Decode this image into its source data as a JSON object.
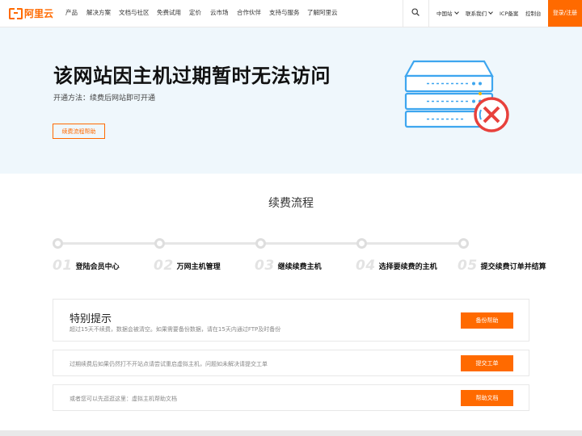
{
  "header": {
    "logo_text": "阿里云",
    "nav": [
      "产品",
      "解决方案",
      "文档与社区",
      "免费试用",
      "定价",
      "云市场",
      "合作伙伴",
      "支持与服务",
      "了解阿里云"
    ],
    "region": "中国站",
    "contact": "联系我们",
    "icp": "ICP备案",
    "console": "控制台",
    "login": "登录/注册"
  },
  "hero": {
    "title": "该网站因主机过期暂时无法访问",
    "subtitle": "开通方法：续费后网站即可开通",
    "button": "续费流程帮助"
  },
  "flow": {
    "title": "续费流程",
    "steps": [
      {
        "num": "01",
        "label": "登陆会员中心"
      },
      {
        "num": "02",
        "label": "万网主机管理"
      },
      {
        "num": "03",
        "label": "继续续费主机"
      },
      {
        "num": "04",
        "label": "选择要续费的主机"
      },
      {
        "num": "05",
        "label": "提交续费订单并结算"
      }
    ]
  },
  "notices": {
    "title": "特别提示",
    "items": [
      {
        "text": "超过15天不续费，数据会被清空。如果需要备份数据，请在15天内通过FTP及时备份",
        "button": "备份帮助"
      },
      {
        "text": "过期续费后如果仍然打不开站点请尝试重启虚拟主机，问题如未解决请提交工单",
        "button": "提交工单"
      },
      {
        "text": "或者您可以先逛逛这里：虚拟主机帮助文档",
        "button": "帮助文档"
      }
    ]
  },
  "colors": {
    "accent": "#ff6a00",
    "hero_bg": "#eff7fc",
    "server_blue": "#3ea6ef",
    "error_red": "#e8413c"
  }
}
